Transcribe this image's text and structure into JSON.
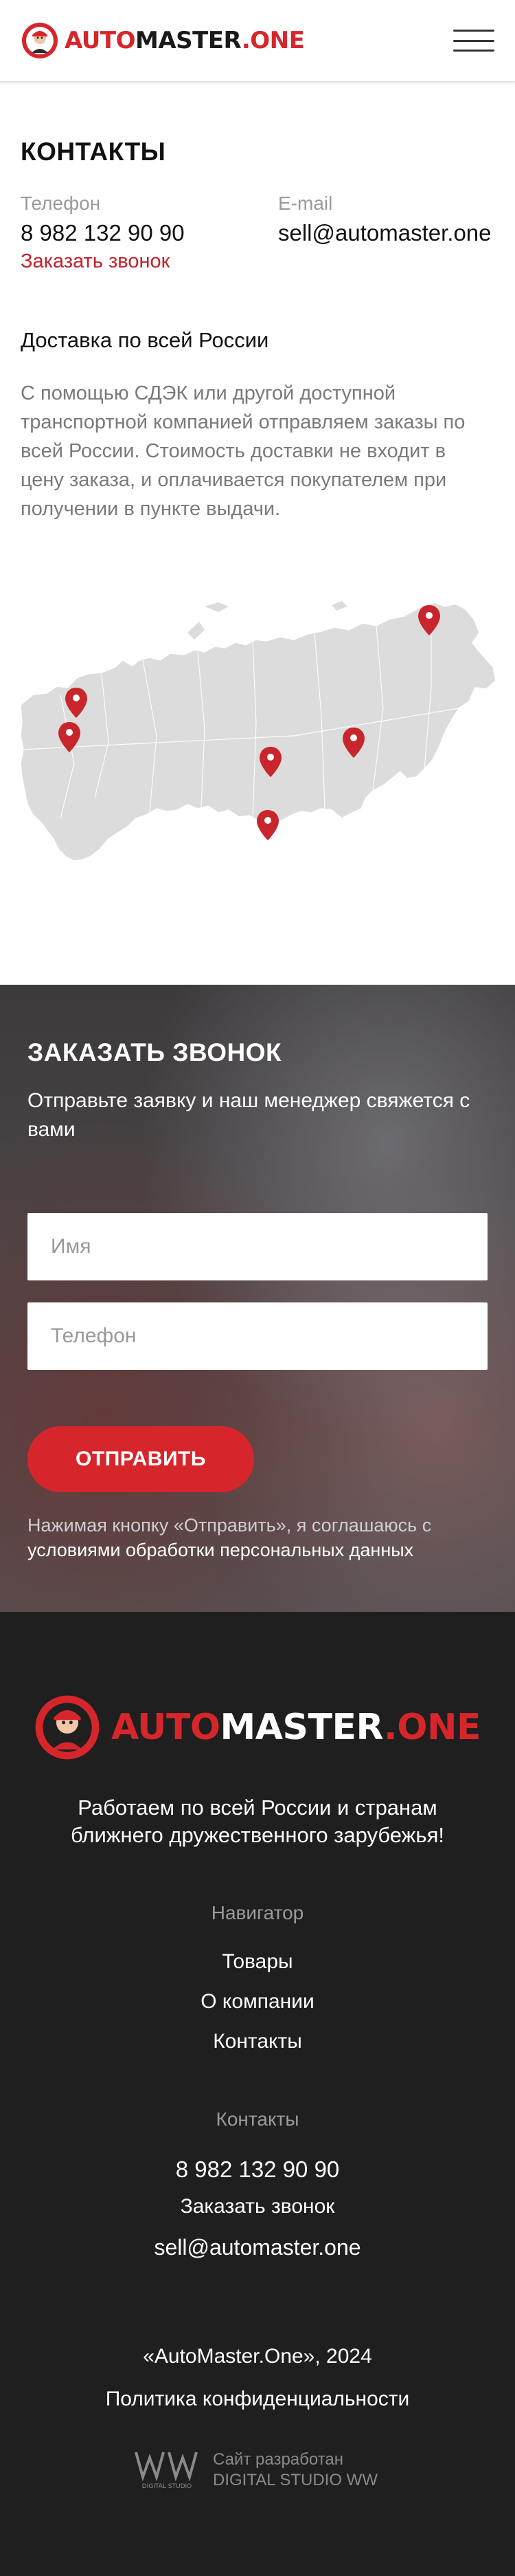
{
  "header": {
    "logo_brand": "AUTO",
    "logo_rest": "MASTER",
    "logo_suffix": ".ONE"
  },
  "contacts": {
    "title": "КОНТАКТЫ",
    "phone_label": "Телефон",
    "phone": "8 982 132 90 90",
    "callback_link": "Заказать звонок",
    "email_label": "E-mail",
    "email": "sell@automaster.one",
    "delivery_title": "Доставка по всей России",
    "delivery_text": "С помощью СДЭК или другой доступной транспортной компанией отправляем заказы по всей России. Стоимость доставки не входит в цену заказа, и оплачивается покупателем при получении в пункте выдачи."
  },
  "callback": {
    "title": "ЗАКАЗАТЬ ЗВОНОК",
    "subtitle": "Отправьте заявку и наш менеджер свяжется с вами",
    "name_placeholder": "Имя",
    "phone_placeholder": "Телефон",
    "submit": "ОТПРАВИТЬ",
    "agree_prefix": "Нажимая кнопку «Отправить», я соглашаюсь с",
    "agree_link": "условиями обработки персональных данных"
  },
  "footer": {
    "tagline_line1": "Работаем по всей России и странам",
    "tagline_line2": "ближнего дружественного зарубежья!",
    "nav_heading": "Навигатор",
    "nav": [
      "Товары",
      "О компании",
      "Контакты"
    ],
    "contacts_heading": "Контакты",
    "phone": "8 982 132 90 90",
    "callback": "Заказать звонок",
    "email": "sell@automaster.one",
    "copyright": "«AutoMaster.One», 2024",
    "privacy": "Политика конфиденциальности",
    "studio_line1": "Сайт разработан",
    "studio_line2": "DIGITAL STUDIO WW",
    "studio_logo_caption": "DIGITAL STUDIO"
  },
  "colors": {
    "accent": "#d6262c",
    "footer_bg": "#1f1f1f",
    "map_fill": "#dcdcdc",
    "pin": "#c8262c"
  },
  "icons": {
    "menu": "hamburger-menu-icon",
    "pin": "map-pin-icon",
    "mascot": "mechanic-mascot-logo"
  }
}
